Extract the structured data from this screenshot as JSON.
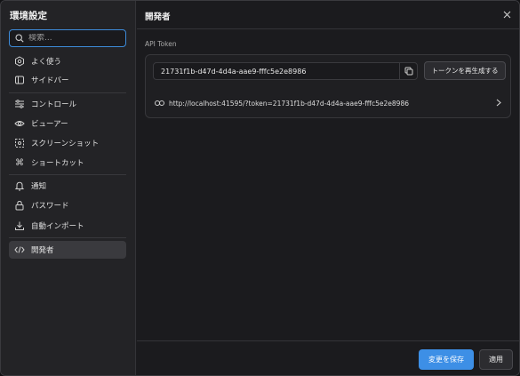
{
  "sidebar": {
    "title": "環境設定",
    "search_placeholder": "検索...",
    "items": [
      {
        "label": "よく使う",
        "icon": "favorites-icon"
      },
      {
        "label": "サイドバー",
        "icon": "sidebar-icon"
      },
      {
        "label": "コントロール",
        "icon": "sliders-icon"
      },
      {
        "label": "ビューアー",
        "icon": "eye-icon"
      },
      {
        "label": "スクリーンショット",
        "icon": "screenshot-icon"
      },
      {
        "label": "ショートカット",
        "icon": "command-icon"
      },
      {
        "label": "通知",
        "icon": "bell-icon"
      },
      {
        "label": "パスワード",
        "icon": "lock-icon"
      },
      {
        "label": "自動インポート",
        "icon": "download-icon"
      },
      {
        "label": "開発者",
        "icon": "code-icon",
        "active": true
      }
    ]
  },
  "main": {
    "title": "開発者",
    "section_label": "API Token",
    "token_value": "21731f1b-d47d-4d4a-aae9-fffc5e2e8986",
    "regenerate_label": "トークンを再生成する",
    "url_text": "http://localhost:41595/?token=21731f1b-d47d-4d4a-aae9-fffc5e2e8986"
  },
  "footer": {
    "save_label": "変更を保存",
    "apply_label": "適用"
  },
  "colors": {
    "accent": "#3d8fe6",
    "focus_border": "#3d8bd9",
    "active_item_bg": "#3a3a3e"
  }
}
